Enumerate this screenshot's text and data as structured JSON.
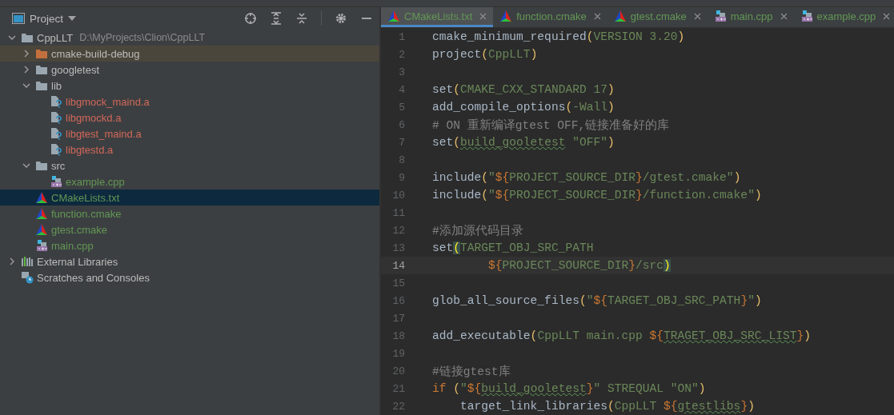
{
  "project_panel": {
    "title": "Project",
    "tree": [
      {
        "name": "CppLLT",
        "hint": "D:\\MyProjects\\Clion\\CppLLT",
        "kind": "folder",
        "color": "#bbbbbb",
        "expanded": true,
        "selected": false,
        "children": [
          {
            "name": "cmake-build-debug",
            "kind": "excluded-folder",
            "color": "#bbbbbb",
            "expanded": false,
            "selected": false
          },
          {
            "name": "googletest",
            "kind": "folder",
            "color": "#bbbbbb",
            "expanded": false,
            "selected": false
          },
          {
            "name": "lib",
            "kind": "folder",
            "color": "#bbbbbb",
            "expanded": true,
            "selected": false,
            "children": [
              {
                "name": "libgmock_maind.a",
                "kind": "unknown-file",
                "color": "#d1675a",
                "selected": false
              },
              {
                "name": "libgmockd.a",
                "kind": "unknown-file",
                "color": "#d1675a",
                "selected": false
              },
              {
                "name": "libgtest_maind.a",
                "kind": "unknown-file",
                "color": "#d1675a",
                "selected": false
              },
              {
                "name": "libgtestd.a",
                "kind": "unknown-file",
                "color": "#d1675a",
                "selected": false
              }
            ]
          },
          {
            "name": "src",
            "kind": "folder",
            "color": "#bbbbbb",
            "expanded": true,
            "selected": false,
            "children": [
              {
                "name": "example.cpp",
                "kind": "cpp",
                "color": "#629755",
                "selected": false
              }
            ]
          },
          {
            "name": "CMakeLists.txt",
            "kind": "cmake",
            "color": "#629755",
            "selected": true
          },
          {
            "name": "function.cmake",
            "kind": "cmake",
            "color": "#629755",
            "selected": false
          },
          {
            "name": "gtest.cmake",
            "kind": "cmake",
            "color": "#629755",
            "selected": false
          },
          {
            "name": "main.cpp",
            "kind": "cpp",
            "color": "#629755",
            "selected": false
          }
        ]
      },
      {
        "name": "External Libraries",
        "kind": "libraries",
        "color": "#bbbbbb",
        "expanded": false,
        "selected": false
      },
      {
        "name": "Scratches and Consoles",
        "kind": "scratches",
        "color": "#bbbbbb",
        "selected": false
      }
    ]
  },
  "editor": {
    "tabs": [
      {
        "label": "CMakeLists.txt",
        "kind": "cmake",
        "selected": true
      },
      {
        "label": "function.cmake",
        "kind": "cmake",
        "selected": false
      },
      {
        "label": "gtest.cmake",
        "kind": "cmake",
        "selected": false
      },
      {
        "label": "main.cpp",
        "kind": "cpp",
        "selected": false
      },
      {
        "label": "example.cpp",
        "kind": "cpp",
        "selected": false
      }
    ],
    "lines": [
      {
        "number": "1",
        "current": false,
        "tokens": [
          {
            "kind": "fn",
            "text": "cmake_minimum_required"
          },
          {
            "kind": "paren",
            "text": "("
          },
          {
            "kind": "arg",
            "text": "VERSION 3.20"
          },
          {
            "kind": "paren",
            "text": ")"
          }
        ]
      },
      {
        "number": "2",
        "current": false,
        "tokens": [
          {
            "kind": "fn",
            "text": "project"
          },
          {
            "kind": "paren",
            "text": "("
          },
          {
            "kind": "arg",
            "text": "CppLLT"
          },
          {
            "kind": "paren",
            "text": ")"
          }
        ]
      },
      {
        "number": "3",
        "current": false
      },
      {
        "number": "4",
        "current": false,
        "tokens": [
          {
            "kind": "fn",
            "text": "set"
          },
          {
            "kind": "paren",
            "text": "("
          },
          {
            "kind": "arg",
            "text": "CMAKE_CXX_STANDARD 17"
          },
          {
            "kind": "paren",
            "text": ")"
          }
        ]
      },
      {
        "number": "5",
        "current": false,
        "tokens": [
          {
            "kind": "fn",
            "text": "add_compile_options"
          },
          {
            "kind": "paren",
            "text": "("
          },
          {
            "kind": "arg",
            "text": "-Wall"
          },
          {
            "kind": "paren",
            "text": ")"
          }
        ]
      },
      {
        "number": "6",
        "current": false,
        "tokens": [
          {
            "kind": "comment",
            "text": "# ON 重新编译gtest OFF,链接准备好的库"
          }
        ]
      },
      {
        "number": "7",
        "current": false,
        "tokens": [
          {
            "kind": "fn",
            "text": "set"
          },
          {
            "kind": "paren",
            "text": "("
          },
          {
            "kind": "typo",
            "text": "build_gooletest"
          },
          {
            "kind": "arg",
            "text": " \"OFF\""
          },
          {
            "kind": "paren",
            "text": ")"
          }
        ]
      },
      {
        "number": "8",
        "current": false
      },
      {
        "number": "9",
        "current": false,
        "tokens": [
          {
            "kind": "fn",
            "text": "include"
          },
          {
            "kind": "paren",
            "text": "("
          },
          {
            "kind": "arg",
            "text": "\""
          },
          {
            "kind": "var",
            "text": "${"
          },
          {
            "kind": "arg",
            "text": "PROJECT_SOURCE_DIR"
          },
          {
            "kind": "var",
            "text": "}"
          },
          {
            "kind": "arg",
            "text": "/gtest.cmake\""
          },
          {
            "kind": "paren",
            "text": ")"
          }
        ]
      },
      {
        "number": "10",
        "current": false,
        "tokens": [
          {
            "kind": "fn",
            "text": "include"
          },
          {
            "kind": "paren",
            "text": "("
          },
          {
            "kind": "arg",
            "text": "\""
          },
          {
            "kind": "var",
            "text": "${"
          },
          {
            "kind": "arg",
            "text": "PROJECT_SOURCE_DIR"
          },
          {
            "kind": "var",
            "text": "}"
          },
          {
            "kind": "arg",
            "text": "/function.cmake\""
          },
          {
            "kind": "paren",
            "text": ")"
          }
        ]
      },
      {
        "number": "11",
        "current": false
      },
      {
        "number": "12",
        "current": false,
        "tokens": [
          {
            "kind": "comment",
            "text": "#添加源代码目录"
          }
        ]
      },
      {
        "number": "13",
        "current": false,
        "tokens": [
          {
            "kind": "fn",
            "text": "set"
          },
          {
            "kind": "match",
            "text": "("
          },
          {
            "kind": "arg",
            "text": "TARGET_OBJ_SRC_PATH"
          }
        ]
      },
      {
        "number": "14",
        "current": true,
        "tokens": [
          {
            "kind": "var",
            "text": "        ${"
          },
          {
            "kind": "arg",
            "text": "PROJECT_SOURCE_DIR"
          },
          {
            "kind": "var",
            "text": "}"
          },
          {
            "kind": "arg",
            "text": "/src"
          },
          {
            "kind": "match",
            "text": ")"
          }
        ]
      },
      {
        "number": "15",
        "current": false
      },
      {
        "number": "16",
        "current": false,
        "tokens": [
          {
            "kind": "fn",
            "text": "glob_all_source_files"
          },
          {
            "kind": "paren",
            "text": "("
          },
          {
            "kind": "arg",
            "text": "\""
          },
          {
            "kind": "var",
            "text": "${"
          },
          {
            "kind": "arg",
            "text": "TARGET_OBJ_SRC_PATH"
          },
          {
            "kind": "var",
            "text": "}"
          },
          {
            "kind": "arg",
            "text": "\""
          },
          {
            "kind": "paren",
            "text": ")"
          }
        ]
      },
      {
        "number": "17",
        "current": false
      },
      {
        "number": "18",
        "current": false,
        "tokens": [
          {
            "kind": "fn",
            "text": "add_executable"
          },
          {
            "kind": "paren",
            "text": "("
          },
          {
            "kind": "arg",
            "text": "CppLLT main.cpp "
          },
          {
            "kind": "var",
            "text": "${"
          },
          {
            "kind": "typo",
            "text": "TRAGET_OBJ_SRC_LIST"
          },
          {
            "kind": "var",
            "text": "}"
          },
          {
            "kind": "paren",
            "text": ")"
          }
        ]
      },
      {
        "number": "19",
        "current": false
      },
      {
        "number": "20",
        "current": false,
        "tokens": [
          {
            "kind": "comment",
            "text": "#链接gtest库"
          }
        ]
      },
      {
        "number": "21",
        "current": false,
        "tokens": [
          {
            "kind": "keyword",
            "text": "if "
          },
          {
            "kind": "paren",
            "text": "("
          },
          {
            "kind": "arg",
            "text": "\""
          },
          {
            "kind": "var",
            "text": "${"
          },
          {
            "kind": "typo",
            "text": "build_gooletest"
          },
          {
            "kind": "var",
            "text": "}"
          },
          {
            "kind": "arg",
            "text": "\" STREQUAL \"ON\""
          },
          {
            "kind": "paren",
            "text": ")"
          }
        ]
      },
      {
        "number": "22",
        "current": false,
        "tokens": [
          {
            "kind": "fn",
            "text": "    target_link_libraries"
          },
          {
            "kind": "paren",
            "text": "("
          },
          {
            "kind": "arg",
            "text": "CppLLT "
          },
          {
            "kind": "var",
            "text": "${"
          },
          {
            "kind": "typo",
            "text": "gtestlibs"
          },
          {
            "kind": "var",
            "text": "}"
          },
          {
            "kind": "paren",
            "text": ")"
          }
        ]
      }
    ]
  }
}
